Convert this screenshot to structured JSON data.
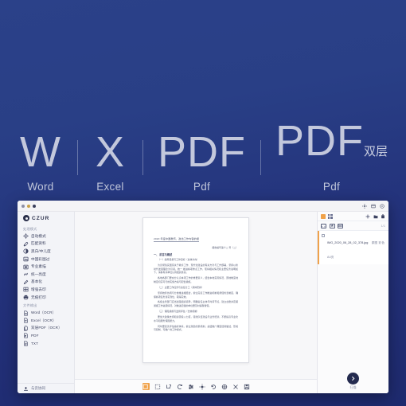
{
  "banner": {
    "formats": [
      {
        "big": "W",
        "sup": "",
        "sub": "Word"
      },
      {
        "big": "X",
        "sup": "",
        "sub": "Excel"
      },
      {
        "big": "PDF",
        "sup": "",
        "sub": "Pdf"
      },
      {
        "big": "PDF",
        "sup": "双层",
        "sub": "Pdf"
      }
    ]
  },
  "window": {
    "title_icons": [
      "gear-icon",
      "window-icon",
      "help-icon"
    ],
    "brand": "CZUR"
  },
  "sidebar": {
    "section_enhance": "处理模式",
    "enhance_items": [
      {
        "label": "自动模式",
        "icon": "auto-icon"
      },
      {
        "label": "匹配资料",
        "icon": "document-icon"
      },
      {
        "label": "黑白/中儿度",
        "icon": "contrast-icon"
      },
      {
        "label": "中国彩图过",
        "icon": "photo-icon"
      },
      {
        "label": "专业素描",
        "icon": "frame-icon"
      },
      {
        "label": "统一亮度",
        "icon": "link-icon"
      },
      {
        "label": "基本化",
        "icon": "edit-icon"
      },
      {
        "label": "增强去印",
        "icon": "grid-icon"
      },
      {
        "label": "无痕打印",
        "icon": "printer-icon"
      }
    ],
    "section_export": "文件输出",
    "export_items": [
      {
        "label": "Word（OCR）",
        "icon": "word-file-icon"
      },
      {
        "label": "Excel（OCR）",
        "icon": "excel-file-icon"
      },
      {
        "label": "双层PDF（OCR）",
        "icon": "pdf-layer-file-icon"
      },
      {
        "label": "PDF",
        "icon": "pdf-file-icon"
      },
      {
        "label": "TXT",
        "icon": "txt-file-icon"
      }
    ],
    "footer_label": "与云协同"
  },
  "document": {
    "title": "2020 年度中国教育、政治工作内容的报",
    "subtitle": "报告编号第十二 号（二）",
    "heading": "一、 前言与概述",
    "paragraphs": [
      "（一）指导思想与工作目标（总体方向）",
      "为贯彻落实国家关于教育工作、现代化建设的有关方针与工作部署，坚持以新时代发展理念为引领，统一 推进各项重点工作，现将相关情况和主要任务说明如下，请各有关单位认真组织落实。",
      "各地各部门要充分认识本项工作的重要意义，结合本地实际情况，因地制宜地制定切实可行的实施方案与配套措施。",
      "（二）主要工作任务与责任分工（具体安排）",
      "坚持统筹协调与分类推进相结合，健全完善工作推进机制和督促检查制度，确保各项任务落实到位、取得实效。",
      "各级主管部门应当加强组织领导，明确责任主体与时间节点，建立台账并定期通报工作进展情况，对推进迟缓的单位要及时提醒督促。",
      "（三）保障措施与监督评估（长效机制）",
      "要加大政策支持和资源投入力度，强化队伍建设与业务培训，不断提高专业化水平和服务保障能力。",
      "同时要完善评估指标体系，健全激励约束机制，总结推广典型经验做法，形成可复制、可推广的工作模式。"
    ]
  },
  "toolbar": {
    "items": [
      {
        "name": "crop-active-icon",
        "label": "裁剪"
      },
      {
        "name": "select-area-icon",
        "label": "框选"
      },
      {
        "name": "trim-icon",
        "label": "修边"
      },
      {
        "name": "rotate-icon",
        "label": "旋转"
      },
      {
        "name": "levels-icon",
        "label": "色阶"
      },
      {
        "name": "brightness-icon",
        "label": "亮度"
      },
      {
        "name": "undo-icon",
        "label": "撤销"
      },
      {
        "name": "color-wheel-icon",
        "label": "调色"
      },
      {
        "name": "flip-icon",
        "label": "翻转"
      },
      {
        "name": "save-icon",
        "label": "保存"
      }
    ]
  },
  "right_panel": {
    "view_modes": [
      "list-view-icon",
      "grid-view-icon"
    ],
    "actions": [
      "add-icon",
      "folder-icon",
      "delete-icon"
    ],
    "sub_actions": [
      "scan-icon",
      "capture-icon",
      "image-icon"
    ],
    "count_label": "1/1",
    "files": [
      {
        "name": "IMG_2020_06_28_02_378.jpg",
        "meta": "原图 彩色 A4页"
      }
    ],
    "next_label": "扫描"
  }
}
